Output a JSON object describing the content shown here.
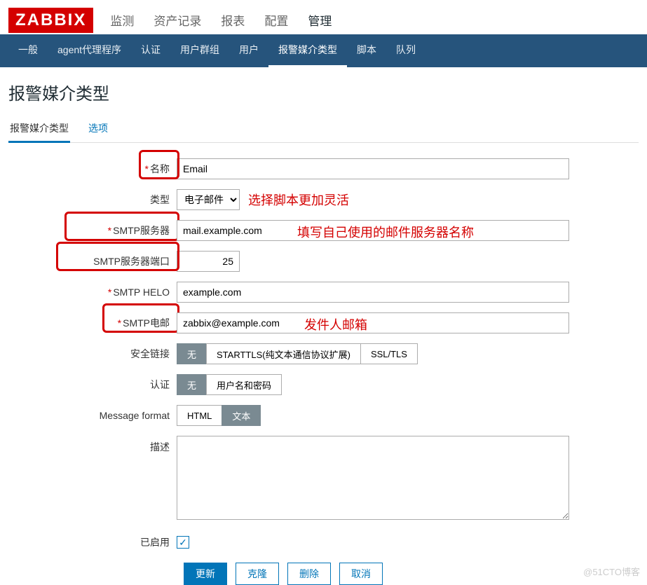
{
  "logo": "ZABBIX",
  "topnav": [
    "监测",
    "资产记录",
    "报表",
    "配置",
    "管理"
  ],
  "topnav_active": 4,
  "subnav": [
    "一般",
    "agent代理程序",
    "认证",
    "用户群组",
    "用户",
    "报警媒介类型",
    "脚本",
    "队列"
  ],
  "subnav_active": 5,
  "page_title": "报警媒介类型",
  "tabs": {
    "items": [
      "报警媒介类型",
      "选项"
    ],
    "active": 0
  },
  "form": {
    "name_label": "名称",
    "name_value": "Email",
    "type_label": "类型",
    "type_value": "电子邮件",
    "smtp_server_label": "SMTP服务器",
    "smtp_server_value": "mail.example.com",
    "smtp_port_label": "SMTP服务器端口",
    "smtp_port_value": "25",
    "smtp_helo_label": "SMTP HELO",
    "smtp_helo_value": "example.com",
    "smtp_email_label": "SMTP电邮",
    "smtp_email_value": "zabbix@example.com",
    "security_label": "安全链接",
    "security_options": [
      "无",
      "STARTTLS(纯文本通信协议扩展)",
      "SSL/TLS"
    ],
    "auth_label": "认证",
    "auth_options": [
      "无",
      "用户名和密码"
    ],
    "msgformat_label": "Message format",
    "msgformat_options": [
      "HTML",
      "文本"
    ],
    "description_label": "描述",
    "enabled_label": "已启用",
    "enabled_checked": true
  },
  "actions": {
    "update": "更新",
    "clone": "克隆",
    "delete": "删除",
    "cancel": "取消"
  },
  "annotations": {
    "type_note": "选择脚本更加灵活",
    "server_note": "填写自己使用的邮件服务器名称",
    "email_note": "发件人邮箱"
  },
  "watermark": "@51CTO博客"
}
